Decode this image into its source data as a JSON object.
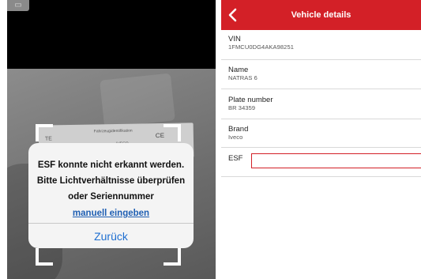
{
  "scanner": {
    "top_button_icon": "window-icon",
    "plate_text_1": "Fahrzeugidentifikation",
    "plate_text_2": "CE",
    "plate_text_3": "IVECO",
    "plate_text_4": "TE",
    "dialog": {
      "line1": "ESF konnte nicht erkannt werden.",
      "line2": "Bitte Lichtverhältnisse überprüfen",
      "line3": "oder Seriennummer",
      "link": "manuell eingeben",
      "button": "Zurück"
    }
  },
  "details": {
    "header_title": "Vehicle details",
    "back_icon": "chevron-left-icon",
    "accent_color": "#d32027",
    "fields": [
      {
        "label": "VIN",
        "value": "1FMCU0DG4AKA98251"
      },
      {
        "label": "Name",
        "value": "NATRAS 6"
      },
      {
        "label": "Plate number",
        "value": "BR 34359"
      },
      {
        "label": "Brand",
        "value": "Iveco"
      }
    ],
    "esf": {
      "label": "ESF",
      "value": "",
      "placeholder": ""
    }
  }
}
